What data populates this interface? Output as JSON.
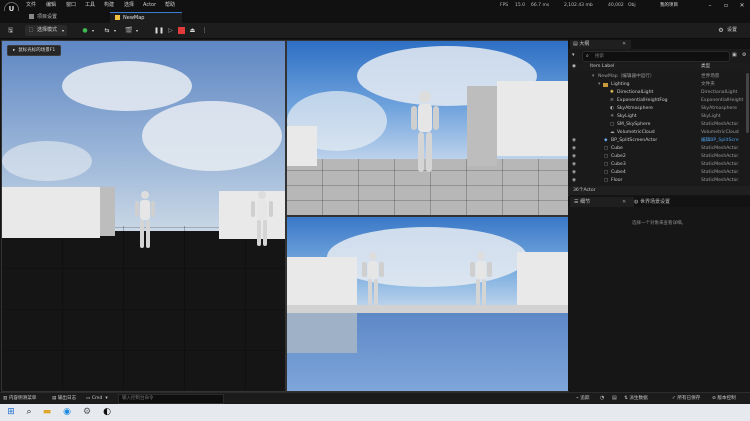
{
  "menu": {
    "items": [
      "文件",
      "编辑",
      "窗口",
      "工具",
      "构建",
      "选择",
      "Actor",
      "帮助"
    ],
    "fps_label": "FPS",
    "fps_value": "15.0",
    "frame_ms": "66.7 ms",
    "mem": "2,102.43 mb",
    "objects": "40,002",
    "objects_label": "Obj",
    "project": "我的项目"
  },
  "tabs": {
    "project_settings": "项目设置",
    "level": "NewMap"
  },
  "toolbar": {
    "mode": "选择模式",
    "settings": "设置"
  },
  "viewport": {
    "hint": "鼠标光标的场景F1"
  },
  "outliner": {
    "tab": "大纲",
    "search_placeholder": "搜索",
    "col_label": "Item Label",
    "col_type": "类型",
    "rows": [
      {
        "label": "NewMap（编辑器中运行）",
        "type": "世界场景"
      },
      {
        "label": "Lighting",
        "type": "文件夹"
      },
      {
        "label": "DirectionalLight",
        "type": "DirectionalLight"
      },
      {
        "label": "ExponentialHeightFog",
        "type": "ExponentialHeight"
      },
      {
        "label": "SkyAtmosphere",
        "type": "SkyAtmosphere"
      },
      {
        "label": "SkyLight",
        "type": "SkyLight"
      },
      {
        "label": "SM_SkySphere",
        "type": "StaticMeshActor"
      },
      {
        "label": "VolumetricCloud",
        "type": "VolumetricCloud"
      },
      {
        "label": "BP_SplitScreenActor",
        "type": "编辑BP_SplitScre"
      },
      {
        "label": "Cube",
        "type": "StaticMeshActor"
      },
      {
        "label": "Cube2",
        "type": "StaticMeshActor"
      },
      {
        "label": "Cube3",
        "type": "StaticMeshActor"
      },
      {
        "label": "Cube4",
        "type": "StaticMeshActor"
      },
      {
        "label": "Floor",
        "type": "StaticMeshActor"
      }
    ],
    "count": "36个Actor"
  },
  "details": {
    "tab": "细节",
    "world_tab": "世界场景设置",
    "empty": "选择一个对象来查看详细。"
  },
  "status": {
    "drawer": "内容侧滑菜单",
    "log": "输出日志",
    "cmd": "Cmd",
    "console_placeholder": "输入控制台命令",
    "trace": "追踪",
    "derived": "派生数据",
    "saved": "所有已保存",
    "revision": "版本控制"
  },
  "colors": {
    "accent": "#1a7ad6",
    "selected_row": "#1f3b5a",
    "folder": "#c89a3c"
  }
}
